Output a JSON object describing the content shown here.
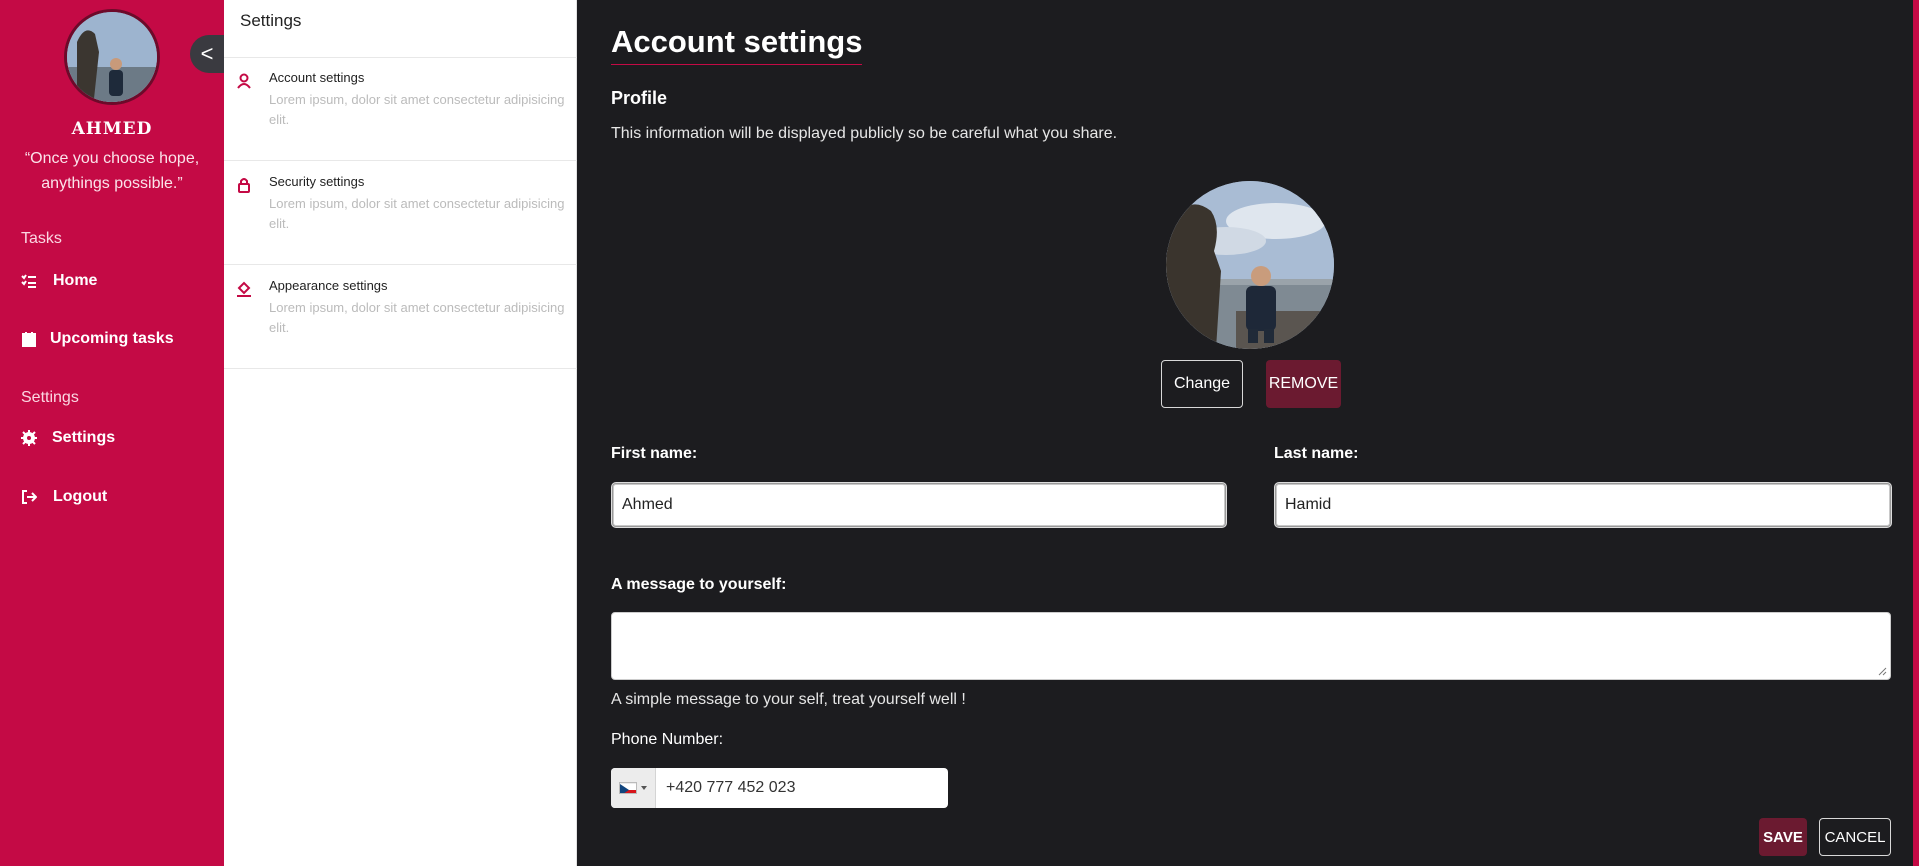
{
  "sidebar": {
    "user_name": "AHMED",
    "quote": "“Once you choose hope, anythings possible.”",
    "sections": [
      {
        "title": "Tasks"
      },
      {
        "title": "Settings"
      }
    ],
    "items": [
      {
        "label": "Home",
        "icon": "task-list-icon"
      },
      {
        "label": "Upcoming tasks",
        "icon": "calendar-icon"
      },
      {
        "label": "Settings",
        "icon": "gear-icon"
      },
      {
        "label": "Logout",
        "icon": "logout-icon"
      }
    ],
    "collapse_glyph": "<"
  },
  "settings_menu": {
    "title": "Settings",
    "items": [
      {
        "label": "Account settings",
        "description": "Lorem ipsum, dolor sit amet consectetur adipisicing elit.",
        "icon": "user-icon"
      },
      {
        "label": "Security settings",
        "description": "Lorem ipsum, dolor sit amet consectetur adipisicing elit.",
        "icon": "lock-icon"
      },
      {
        "label": "Appearance settings",
        "description": "Lorem ipsum, dolor sit amet consectetur adipisicing elit.",
        "icon": "paint-bucket-icon"
      }
    ]
  },
  "main": {
    "title": "Account settings",
    "profile_heading": "Profile",
    "profile_description": "This information will be displayed publicly so be careful what you share.",
    "change_label": "Change",
    "remove_label": "REMOVE",
    "first_name_label": "First name:",
    "first_name_value": "Ahmed",
    "last_name_label": "Last name:",
    "last_name_value": "Hamid",
    "message_label": "A message to yourself:",
    "message_value": "",
    "message_hint": "A simple message to your self, treat yourself well !",
    "phone_label": "Phone Number:",
    "phone_value": "+420 777 452 023",
    "phone_country_flag": "czech-flag-icon",
    "save_label": "SAVE",
    "cancel_label": "CANCEL"
  },
  "colors": {
    "accent": "#c40a45",
    "dark_background": "#1c1c1f",
    "button_dark_red": "#6b1a30"
  }
}
